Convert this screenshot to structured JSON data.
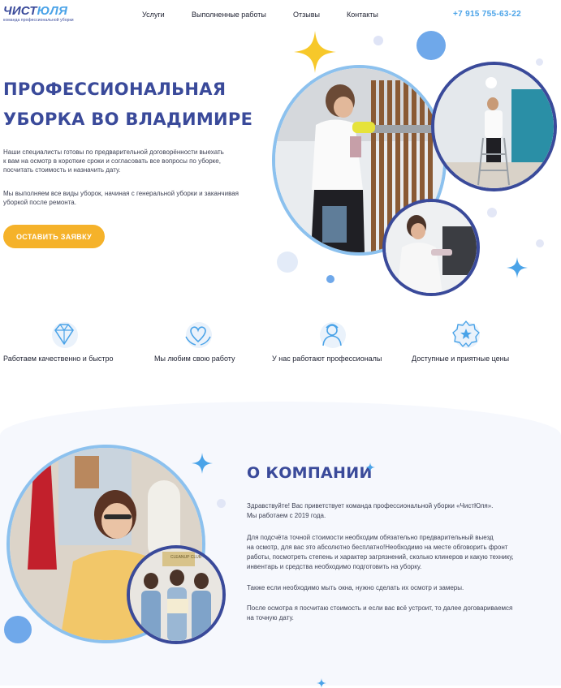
{
  "header": {
    "logo_part1": "ЧИСТ",
    "logo_part2": "ЮЛЯ",
    "logo_tagline": "команда профессиональной уборки",
    "nav": [
      "Услуги",
      "Выполненные работы",
      "Отзывы",
      "Контакты"
    ],
    "phone": "+7 915 755-63-22"
  },
  "hero": {
    "title_line1": "ПРОФЕССИОНАЛЬНАЯ",
    "title_line2": "УБОРКА ВО ВЛАДИМИРЕ",
    "paragraph1": [
      "Наши специалисты готовы по предварительной договорённости выехать",
      "к вам на осмотр в короткие сроки и согласовать все вопросы по уборке,",
      "посчитать стоимость и назначить дату."
    ],
    "paragraph2": [
      "Мы выполняем все виды уборок, начиная с генеральной уборки и заканчивая",
      "уборкой после ремонта."
    ],
    "button": "ОСТАВИТЬ ЗАЯВКУ"
  },
  "features": [
    {
      "icon": "diamond-icon",
      "label": "Работаем качественно и быстро"
    },
    {
      "icon": "heart-hands-icon",
      "label": "Мы любим свою работу"
    },
    {
      "icon": "worker-icon",
      "label": "У нас работают профессионалы"
    },
    {
      "icon": "badge-star-icon",
      "label": "Доступные и приятные цены"
    }
  ],
  "about": {
    "title": "О КОМПАНИИ",
    "p1": [
      "Здравствуйте! Вас приветствует команда профессиональной уборки «ЧистЮля».",
      "Мы работаем с 2019 года."
    ],
    "p2": [
      "Для подсчёта точной стоимости необходим обязательно предварительный выезд",
      "на осмотр, для вас это абсолютно бесплатно!Необходимо на месте обговорить фронт",
      "работы, посмотреть степень и характер загрязнений, сколько клинеров и какую технику,",
      "инвентарь и средства необходимо подготовить на уборку."
    ],
    "p3": [
      "Также если необходимо мыть окна, нужно сделать их осмотр и замеры."
    ],
    "p4": [
      "После осмотра я посчитаю стоимость и если вас всё устроит, то далее договариваемся",
      "на точную дату."
    ],
    "badge_text": "CLEANUP CLUB"
  },
  "colors": {
    "brand_dark": "#3a4a9a",
    "brand_light": "#4aa3e8",
    "accent_yellow": "#f5b22a",
    "bubble_blue": "#6fa8ea"
  }
}
